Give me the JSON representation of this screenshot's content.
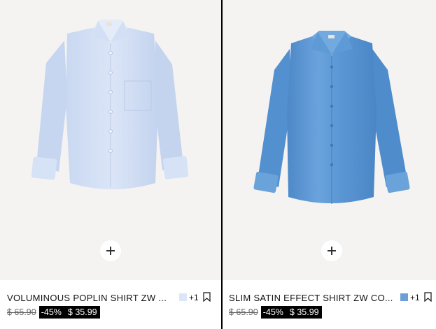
{
  "products": [
    {
      "name": "VOLUMINOUS POPLIN SHIRT ZW ...",
      "swatch_color": "#dbe6f7",
      "more_colors": "+1",
      "old_price": "$ 65.90",
      "discount": "-45%",
      "sale_price": "$ 35.99",
      "shirt_color": "#cfdcf3",
      "icons": [
        "plus-icon",
        "bookmark-icon"
      ]
    },
    {
      "name": "SLIM SATIN EFFECT SHIRT ZW CO...",
      "swatch_color": "#6d9fd6",
      "more_colors": "+1",
      "old_price": "$ 65.90",
      "discount": "-45%",
      "sale_price": "$ 35.99",
      "shirt_color": "#5c97d3",
      "icons": [
        "plus-icon",
        "bookmark-icon"
      ]
    }
  ]
}
